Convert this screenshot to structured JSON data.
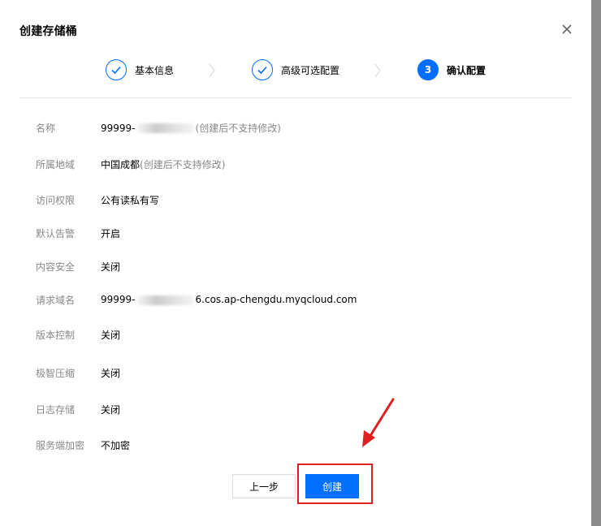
{
  "dialog": {
    "title": "创建存储桶",
    "close_icon": "close-icon"
  },
  "steps": [
    {
      "label": "基本信息",
      "state": "done"
    },
    {
      "label": "高级可选配置",
      "state": "done"
    },
    {
      "number": "3",
      "label": "确认配置",
      "state": "active"
    }
  ],
  "details": {
    "name": {
      "label": "名称",
      "value_prefix": "99999-",
      "value_suffix": "(创建后不支持修改)"
    },
    "region": {
      "label": "所属地域",
      "value": "中国成都",
      "hint": "(创建后不支持修改)"
    },
    "access": {
      "label": "访问权限",
      "value": "公有读私有写"
    },
    "alarm": {
      "label": "默认告警",
      "value": "开启"
    },
    "content_security": {
      "label": "内容安全",
      "value": "关闭"
    },
    "domain": {
      "label": "请求域名",
      "value_prefix": "99999-",
      "value_suffix": "6.cos.ap-chengdu.myqcloud.com"
    },
    "versioning": {
      "label": "版本控制",
      "value": "关闭"
    },
    "compression": {
      "label": "极智压缩",
      "value": "关闭"
    },
    "logging": {
      "label": "日志存储",
      "value": "关闭"
    },
    "encryption": {
      "label": "服务端加密",
      "value": "不加密"
    }
  },
  "footer": {
    "prev_label": "上一步",
    "create_label": "创建"
  },
  "colors": {
    "primary": "#006eff",
    "annotation_red": "#e02020"
  }
}
